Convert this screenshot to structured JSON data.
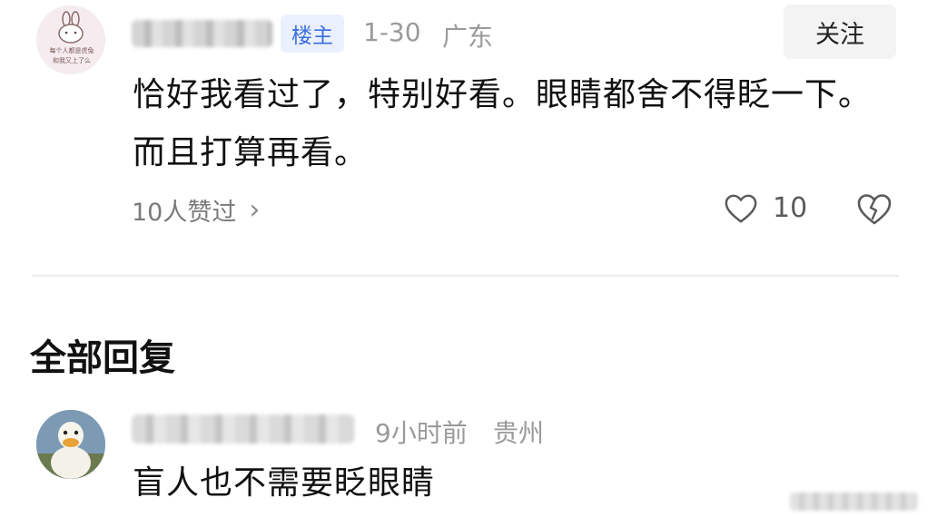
{
  "op": {
    "badge": "楼主",
    "date": "1-30",
    "location": "广东",
    "follow_label": "关注",
    "text": "恰好我看过了，特别好看。眼睛都舍不得眨一下。而且打算再看。",
    "likers_label": "10人赞过",
    "like_count": "10",
    "avatar_text_line1": "每个人都是虎兔",
    "avatar_text_line2": "和我又上了么"
  },
  "section_title": "全部回复",
  "reply": {
    "time": "9小时前",
    "location": "贵州",
    "text": "盲人也不需要眨眼睛"
  },
  "icons": {
    "like": "heart-outline-icon",
    "dislike": "broken-heart-icon",
    "chevron": "chevron-right-icon"
  },
  "colors": {
    "badge_text": "#3a6fe0",
    "badge_bg": "#eaf0fd",
    "meta": "#9a9a9a"
  }
}
